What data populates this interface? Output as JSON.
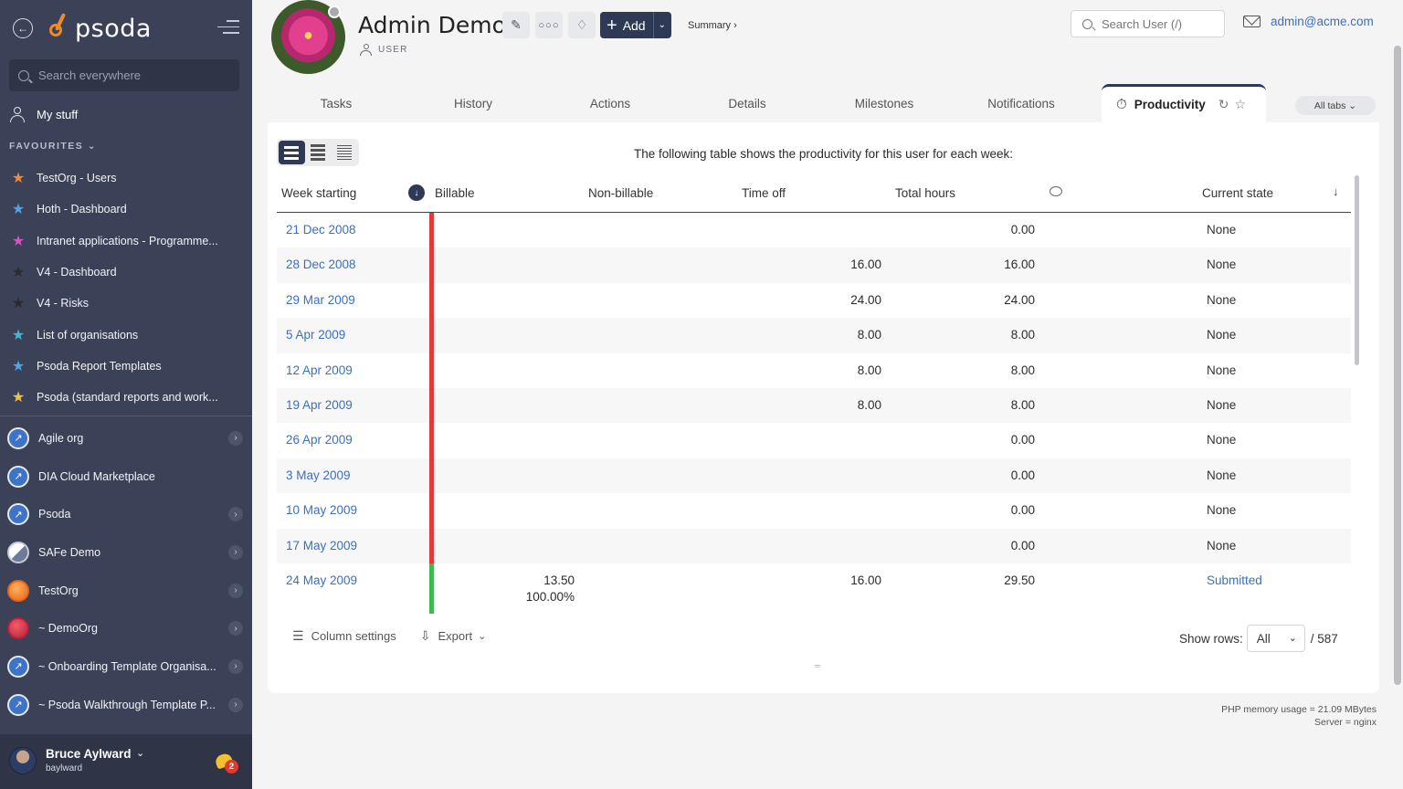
{
  "sidebar": {
    "logo_text": "psoda",
    "search_placeholder": "Search everywhere",
    "my_stuff": "My stuff",
    "favourites_heading": "FAVOURITES",
    "favourites": [
      {
        "label": "TestOrg - Users",
        "color": "#f08a3c"
      },
      {
        "label": "Hoth - Dashboard",
        "color": "#4fa3e8"
      },
      {
        "label": "Intranet applications - Programme...",
        "color": "#d84fc4"
      },
      {
        "label": "V4 - Dashboard",
        "color": "#2b2b2b"
      },
      {
        "label": "V4 - Risks",
        "color": "#2b2b2b"
      },
      {
        "label": "List of organisations",
        "color": "#3fb7d8"
      },
      {
        "label": "Psoda Report Templates",
        "color": "#4fa3e8"
      },
      {
        "label": "Psoda (standard reports and work...",
        "color": "#f2c14a"
      }
    ],
    "organisations": [
      {
        "label": "Agile org",
        "type": "psoda",
        "has_children": true
      },
      {
        "label": "DIA Cloud Marketplace",
        "type": "psoda",
        "has_children": false
      },
      {
        "label": "Psoda",
        "type": "psoda",
        "has_children": true
      },
      {
        "label": "SAFe Demo",
        "type": "safe",
        "has_children": true
      },
      {
        "label": "TestOrg",
        "type": "testorg",
        "has_children": true
      },
      {
        "label": "~ DemoOrg",
        "type": "demoorg",
        "has_children": true
      },
      {
        "label": "~ Onboarding Template Organisa...",
        "type": "psoda",
        "has_children": true
      },
      {
        "label": "~ Psoda Walkthrough Template P...",
        "type": "psoda",
        "has_children": true
      }
    ],
    "user": {
      "name": "Bruce Aylward",
      "handle": "baylward",
      "notifications": "2"
    }
  },
  "header": {
    "title": "Admin Demo",
    "subtitle": "USER",
    "add_label": "Add",
    "summary_link": "Summary ›",
    "search_placeholder": "Search User (/)",
    "email": "admin@acme.com"
  },
  "tabs": [
    {
      "label": "Tasks"
    },
    {
      "label": "History"
    },
    {
      "label": "Actions"
    },
    {
      "label": "Details"
    },
    {
      "label": "Milestones"
    },
    {
      "label": "Notifications"
    },
    {
      "label": "Productivity",
      "active": true
    }
  ],
  "all_tabs_label": "All tabs",
  "main": {
    "intro": "The following table shows the productivity for this user for each week:",
    "columns": {
      "week_starting": "Week starting",
      "billable": "Billable",
      "non_billable": "Non-billable",
      "time_off": "Time off",
      "total_hours": "Total hours",
      "current_state": "Current state"
    },
    "rows": [
      {
        "week": "21 Dec 2008",
        "billable": "",
        "time_off": "",
        "total": "0.00",
        "state": "None",
        "status_color": "red"
      },
      {
        "week": "28 Dec 2008",
        "billable": "",
        "time_off": "16.00",
        "total": "16.00",
        "state": "None",
        "status_color": "red"
      },
      {
        "week": "29 Mar 2009",
        "billable": "",
        "time_off": "24.00",
        "total": "24.00",
        "state": "None",
        "status_color": "red"
      },
      {
        "week": "5 Apr 2009",
        "billable": "",
        "time_off": "8.00",
        "total": "8.00",
        "state": "None",
        "status_color": "red"
      },
      {
        "week": "12 Apr 2009",
        "billable": "",
        "time_off": "8.00",
        "total": "8.00",
        "state": "None",
        "status_color": "red"
      },
      {
        "week": "19 Apr 2009",
        "billable": "",
        "time_off": "8.00",
        "total": "8.00",
        "state": "None",
        "status_color": "red"
      },
      {
        "week": "26 Apr 2009",
        "billable": "",
        "time_off": "",
        "total": "0.00",
        "state": "None",
        "status_color": "red"
      },
      {
        "week": "3 May 2009",
        "billable": "",
        "time_off": "",
        "total": "0.00",
        "state": "None",
        "status_color": "red"
      },
      {
        "week": "10 May 2009",
        "billable": "",
        "time_off": "",
        "total": "0.00",
        "state": "None",
        "status_color": "red"
      },
      {
        "week": "17 May 2009",
        "billable": "",
        "time_off": "",
        "total": "0.00",
        "state": "None",
        "status_color": "red"
      },
      {
        "week": "24 May 2009",
        "billable": "13.50",
        "billable_pct": "100.00%",
        "time_off": "16.00",
        "total": "29.50",
        "state": "Submitted",
        "status_color": "green"
      }
    ],
    "column_settings": "Column settings",
    "export": "Export",
    "show_rows_label": "Show rows:",
    "show_rows_value": "All",
    "total_count": "/ 587"
  },
  "sysinfo": {
    "memory": "PHP memory usage = 21.09 MBytes",
    "server": "Server = nginx"
  }
}
